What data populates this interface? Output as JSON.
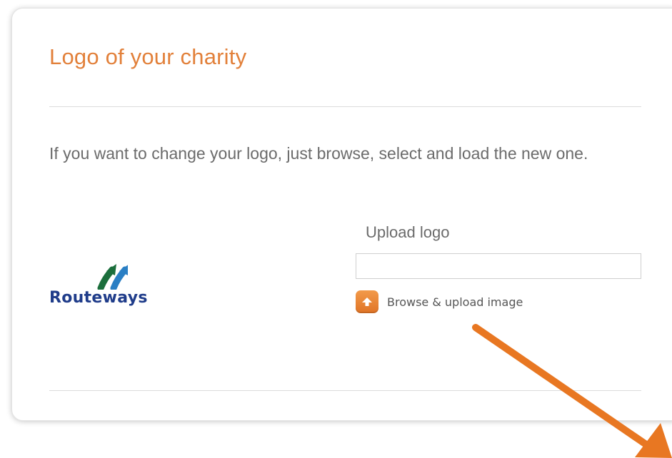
{
  "section": {
    "title": "Logo of your charity",
    "description": "If you want to change your logo, just browse, select and load the new one."
  },
  "logo": {
    "text": "Routeways"
  },
  "upload": {
    "label": "Upload logo",
    "value": "",
    "browse_label": "Browse & upload image"
  },
  "colors": {
    "accent": "#e2803a",
    "logo_text": "#1f3c8a",
    "annotation_arrow": "#e87722"
  },
  "icons": {
    "browse": "upload-arrow-icon"
  }
}
